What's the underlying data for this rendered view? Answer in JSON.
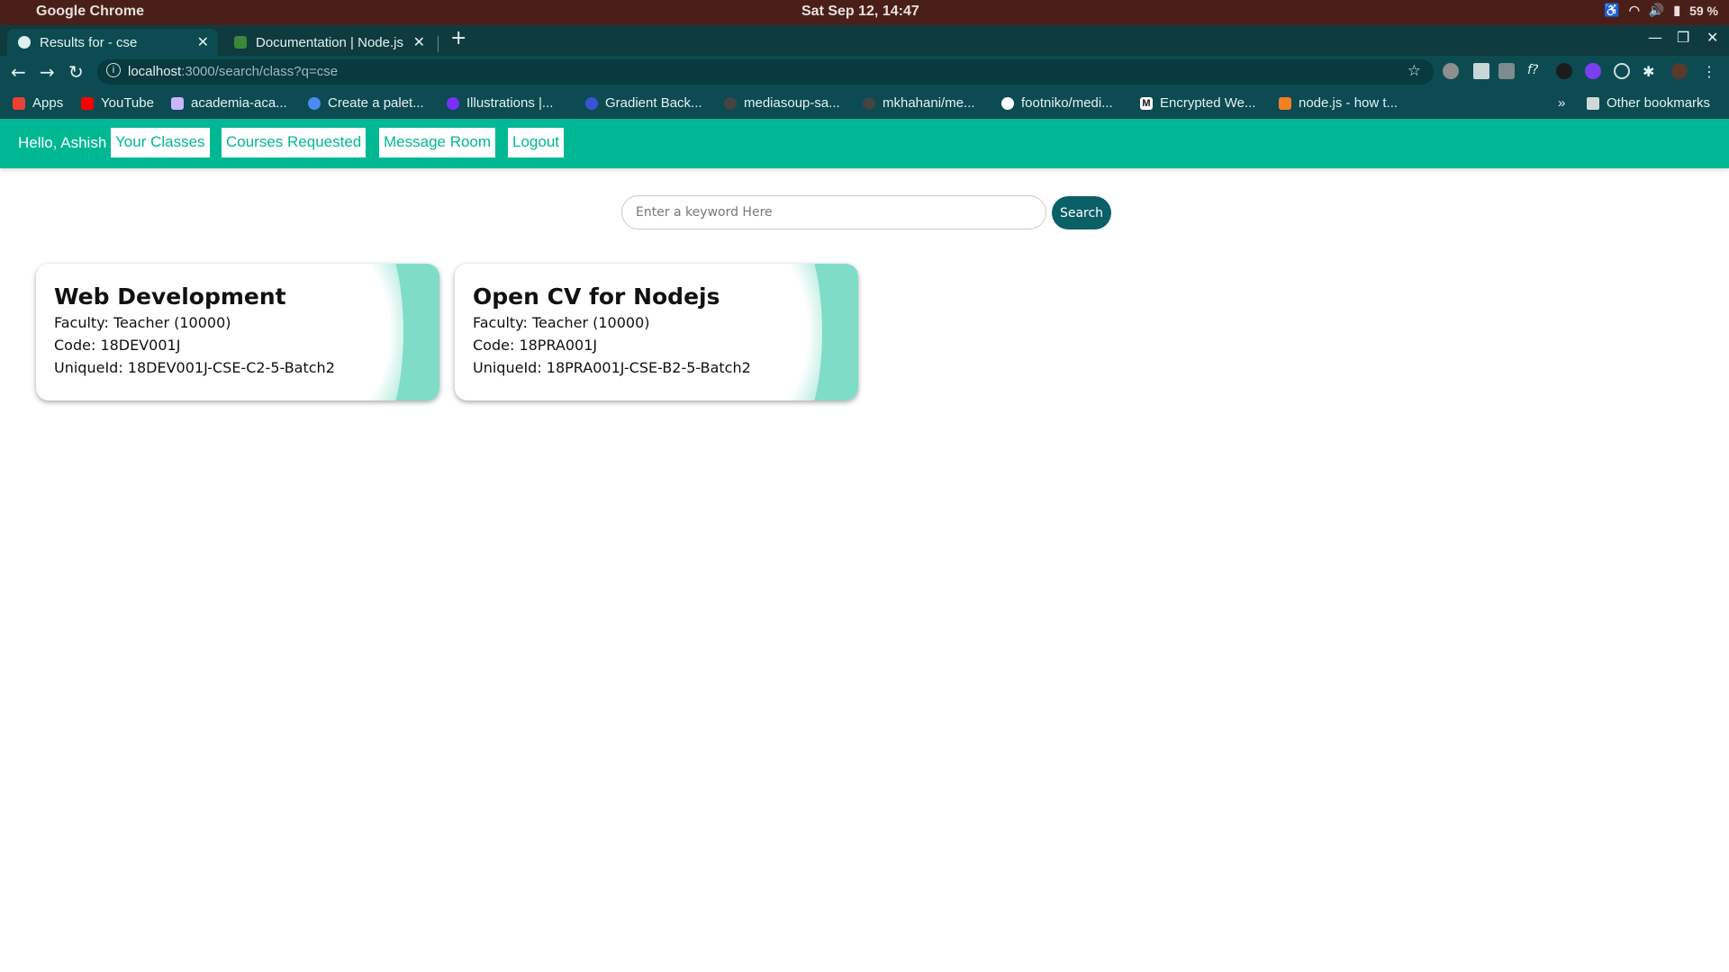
{
  "os": {
    "app_name": "Google Chrome",
    "clock": "Sat Sep 12, 14:47",
    "battery": "59 %"
  },
  "browser": {
    "tabs": [
      {
        "title": "Results for - cse",
        "active": true
      },
      {
        "title": "Documentation | Node.js",
        "active": false
      }
    ],
    "url_host": "localhost",
    "url_rest": ":3000/search/class?q=cse",
    "bookmarks": [
      {
        "label": "Apps",
        "color": "#e94235"
      },
      {
        "label": "YouTube",
        "color": "#ff0000"
      },
      {
        "label": "academia-aca...",
        "color": "#c9b6ff"
      },
      {
        "label": "Create a palet...",
        "color": "#4c8bf5"
      },
      {
        "label": "Illustrations |...",
        "color": "#7b2ff7"
      },
      {
        "label": "Gradient Back...",
        "color": "#3a53d6"
      },
      {
        "label": "mediasoup-sa...",
        "color": "#444444"
      },
      {
        "label": "mkhahani/me...",
        "color": "#444444"
      },
      {
        "label": "footniko/medi...",
        "color": "#ffffff"
      },
      {
        "label": "Encrypted We...",
        "color": "#111111"
      },
      {
        "label": "node.js - how t...",
        "color": "#f48024"
      }
    ],
    "more_bookmarks": "»",
    "other_bookmarks": "Other bookmarks"
  },
  "navbar": {
    "greeting": "Hello, Ashish",
    "links": [
      "Your Classes",
      "Courses Requested",
      "Message Room",
      "Logout"
    ]
  },
  "search": {
    "placeholder": "Enter a keyword Here",
    "button_label": "Search"
  },
  "classes": [
    {
      "title": "Web Development",
      "faculty": "Faculty: Teacher (10000)",
      "code": "Code: 18DEV001J",
      "unique_id": "UniqueId: 18DEV001J-CSE-C2-5-Batch2"
    },
    {
      "title": "Open CV for Nodejs",
      "faculty": "Faculty: Teacher (10000)",
      "code": "Code: 18PRA001J",
      "unique_id": "UniqueId: 18PRA001J-CSE-B2-5-Batch2"
    }
  ],
  "colors": {
    "navbar": "#00b894",
    "search_button": "#0b5f66",
    "card_accent": "#7fdcc7"
  }
}
